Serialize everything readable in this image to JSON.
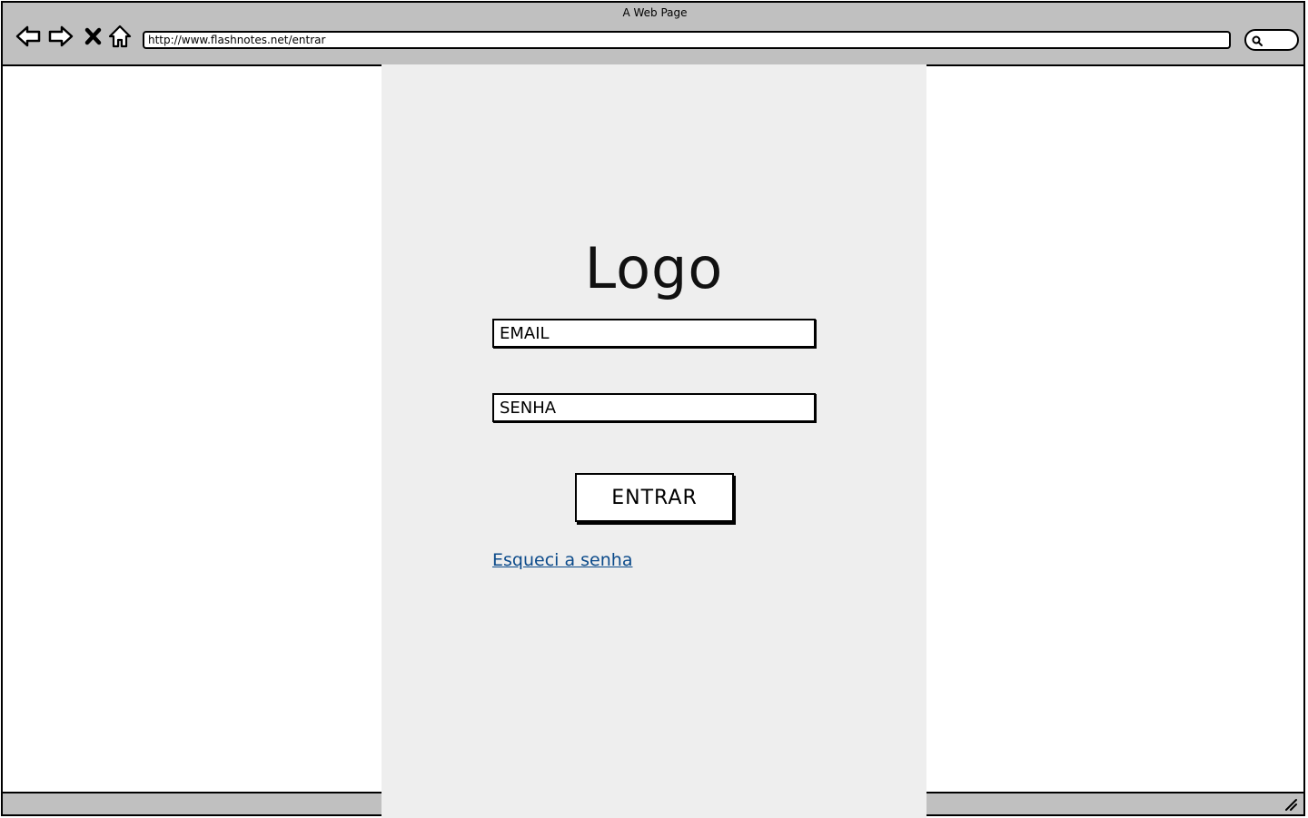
{
  "window": {
    "title": "A Web Page"
  },
  "browser": {
    "url": "http://www.flashnotes.net/entrar",
    "icons": [
      "back-arrow-icon",
      "forward-arrow-icon",
      "close-x-icon",
      "home-icon",
      "search-icon",
      "resize-grip-icon"
    ]
  },
  "login": {
    "logo": "Logo",
    "email_placeholder": "EMAIL",
    "password_placeholder": "SENHA",
    "submit_label": "ENTRAR",
    "forgot_link": "Esqueci a senha"
  },
  "colors": {
    "chrome": "#c0c0c0",
    "panel": "#eeeeee",
    "link": "#0b4a8a"
  }
}
